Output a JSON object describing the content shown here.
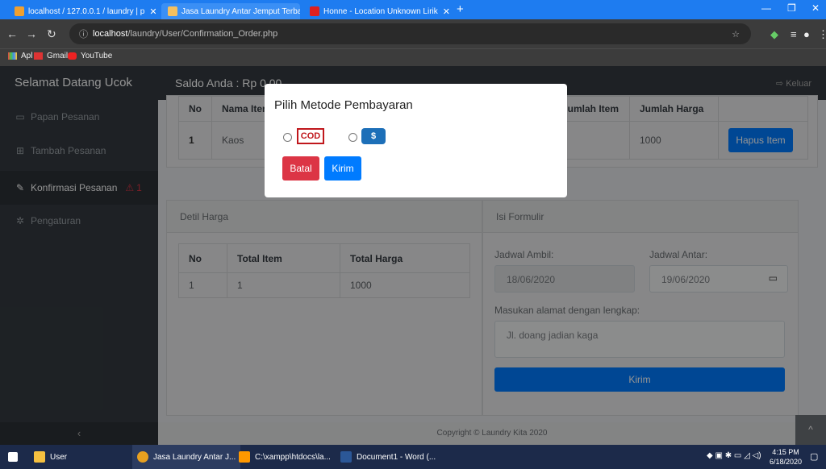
{
  "browser": {
    "tabs": [
      {
        "title": "localhost / 127.0.0.1 / laundry | p",
        "active": false
      },
      {
        "title": "Jasa Laundry Antar Jemput Terba",
        "active": true
      },
      {
        "title": "Honne - Location Unknown Lirik",
        "active": false
      }
    ],
    "url_host": "localhost",
    "url_path": "/laundry/User/Confirmation_Order.php",
    "bookmarks": [
      "Apl",
      "Gmail",
      "YouTube"
    ]
  },
  "app": {
    "brand": "Selamat Datang Ucok",
    "saldo": "Saldo Anda : Rp 0,00",
    "logout": "Keluar",
    "sidebar": [
      {
        "label": "Papan Pesanan",
        "icon": "table-icon"
      },
      {
        "label": "Tambah Pesanan",
        "icon": "basket-icon"
      },
      {
        "label": "Konfirmasi Pesanan",
        "icon": "edit-icon",
        "badge": "1"
      },
      {
        "label": "Pengaturan",
        "icon": "gear-icon"
      }
    ],
    "sidebar_toggle": "‹"
  },
  "order_table": {
    "headers": [
      "No",
      "Nama Item",
      "Jumlah Item",
      "Jumlah Harga"
    ],
    "row": {
      "no": "1",
      "name": "Kaos",
      "total": "1000"
    },
    "delete_label": "Hapus Item"
  },
  "price_card": {
    "title": "Detil Harga",
    "headers": [
      "No",
      "Total Item",
      "Total Harga"
    ],
    "row": [
      "1",
      "1",
      "1000"
    ]
  },
  "form_card": {
    "title": "Isi Formulir",
    "pickup_label": "Jadwal Ambil:",
    "pickup_value": "18/06/2020",
    "delivery_label": "Jadwal Antar:",
    "delivery_value": "19/06/2020",
    "address_label": "Masukan alamat dengan lengkap:",
    "address_value": "Jl. doang jadian kaga",
    "submit_label": "Kirim"
  },
  "footer": "Copyright © Laundry Kita 2020",
  "modal": {
    "title": "Pilih Metode Pembayaran",
    "option_cod": "COD",
    "cancel_label": "Batal",
    "send_label": "Kirim"
  },
  "taskbar": {
    "items": [
      "User",
      "Jasa Laundry Antar J...",
      "C:\\xampp\\htdocs\\la...",
      "Document1 - Word (..."
    ],
    "time": "4:15 PM",
    "date": "6/18/2020"
  },
  "colors": {
    "danger": "#dc3545",
    "primary": "#007bff",
    "dark": "#343a40"
  }
}
